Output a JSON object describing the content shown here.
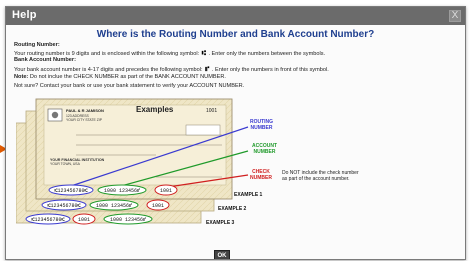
{
  "dialog": {
    "title": "Help",
    "close_label": "X",
    "heading": "Where is the Routing Number and Bank Account Number?",
    "routing_heading": "Routing Number:",
    "routing_text_a": "Your routing number is 9 digits and is enclosed within the following symbol:",
    "routing_symbol": "⑆",
    "routing_text_b": ". Enter only the numbers between the symbols.",
    "account_heading": "Bank Account Number:",
    "account_text_a": "Your bank account number is 4-17 digits and precedes the following symbol:",
    "account_symbol": "⑈",
    "account_text_b": ". Enter only the numbers in front of this symbol.",
    "note_label": "Note:",
    "note_text": "Do not inclue the CHECK NUMBER as part of the BANK ACCOUNT NUMBER.",
    "not_sure_text": "Not sure? Contact your bank or use your bank statement to verify your ACCOUNT NUMBER.",
    "ok_label": "OK"
  },
  "illustration": {
    "examples_title": "Examples",
    "check_number_top": "1001",
    "payer_name": "PAUL & R JAMISON",
    "payer_address1": "123 ADDRESS",
    "payer_address2": "YOUR CITY STATE ZIP",
    "memo_bank": "YOUR FINANCIAL INSTITUTION",
    "memo_city": "YOUR TOWN, USA",
    "routing_label_1": "ROUTING",
    "routing_label_2": "NUMBER",
    "account_label_1": "ACCOUNT",
    "account_label_2": "NUMBER",
    "check_label_1": "CHECK",
    "check_label_2": "NUMBER",
    "check_note_1": "Do NOT include the check number",
    "check_note_2": "as part of the account number.",
    "example_1": "EXAMPLE 1",
    "example_2": "EXAMPLE 2",
    "example_3": "EXAMPLE 3",
    "micr_1_routing": "⑆123456780⑆",
    "micr_1_account": "1000 123456⑈",
    "micr_1_check": "1001",
    "micr_2_routing": "⑆123456780⑆",
    "micr_2_account": "1000 123456⑈",
    "micr_2_check": "1001",
    "micr_3_routing": "⑆123456780⑆",
    "micr_3_check": "1001",
    "micr_3_account": "1000 123456⑈",
    "colors": {
      "routing": "#3a3ad0",
      "account": "#1f9a2a",
      "check": "#d01f1f",
      "heading": "#1f3f8f"
    }
  }
}
